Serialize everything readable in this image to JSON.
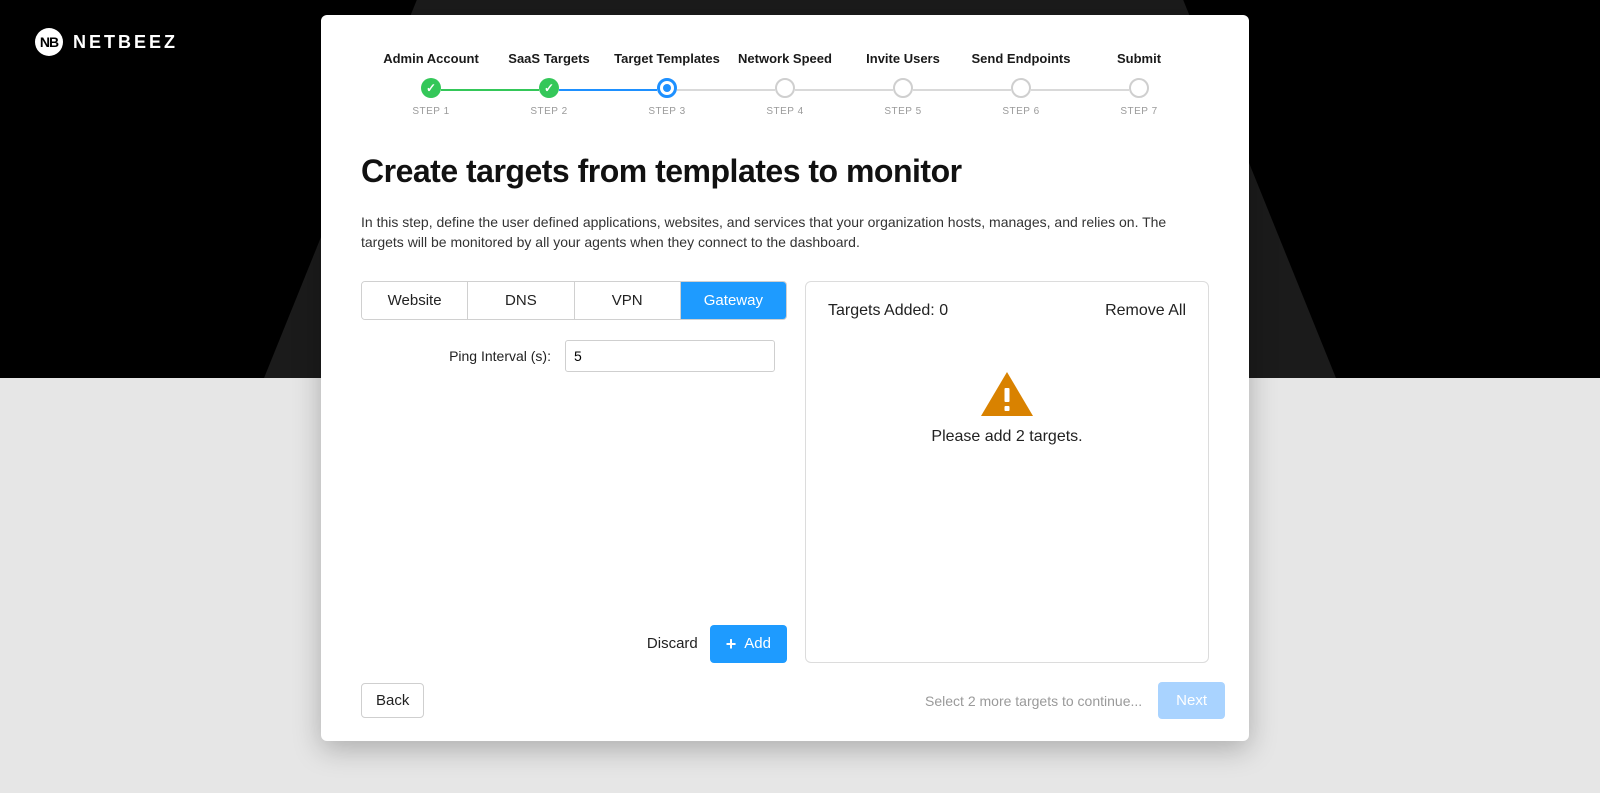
{
  "brand": {
    "mark": "NB",
    "name": "NETBEEZ"
  },
  "stepper": {
    "steps": [
      {
        "label": "Admin Account",
        "sub": "STEP 1",
        "state": "done"
      },
      {
        "label": "SaaS Targets",
        "sub": "STEP 2",
        "state": "done"
      },
      {
        "label": "Target Templates",
        "sub": "STEP 3",
        "state": "current"
      },
      {
        "label": "Network Speed",
        "sub": "STEP 4",
        "state": "pending"
      },
      {
        "label": "Invite Users",
        "sub": "STEP 5",
        "state": "pending"
      },
      {
        "label": "Send Endpoints",
        "sub": "STEP 6",
        "state": "pending"
      },
      {
        "label": "Submit",
        "sub": "STEP 7",
        "state": "pending"
      }
    ]
  },
  "heading": "Create targets from templates to monitor",
  "description": "In this step, define the user defined applications, websites, and services that your organization hosts, manages, and relies on. The targets will be monitored by all your agents when they connect to the dashboard.",
  "tabs": {
    "items": [
      "Website",
      "DNS",
      "VPN",
      "Gateway"
    ],
    "active": "Gateway"
  },
  "form": {
    "ping_interval_label": "Ping Interval (s):",
    "ping_interval_value": "5"
  },
  "left_actions": {
    "discard": "Discard",
    "add": "Add"
  },
  "targets_panel": {
    "added_label": "Targets Added: ",
    "added_count": "0",
    "remove_all": "Remove All",
    "empty_message": "Please add 2 targets."
  },
  "footer": {
    "back": "Back",
    "hint": "Select 2 more targets to continue...",
    "next": "Next"
  }
}
